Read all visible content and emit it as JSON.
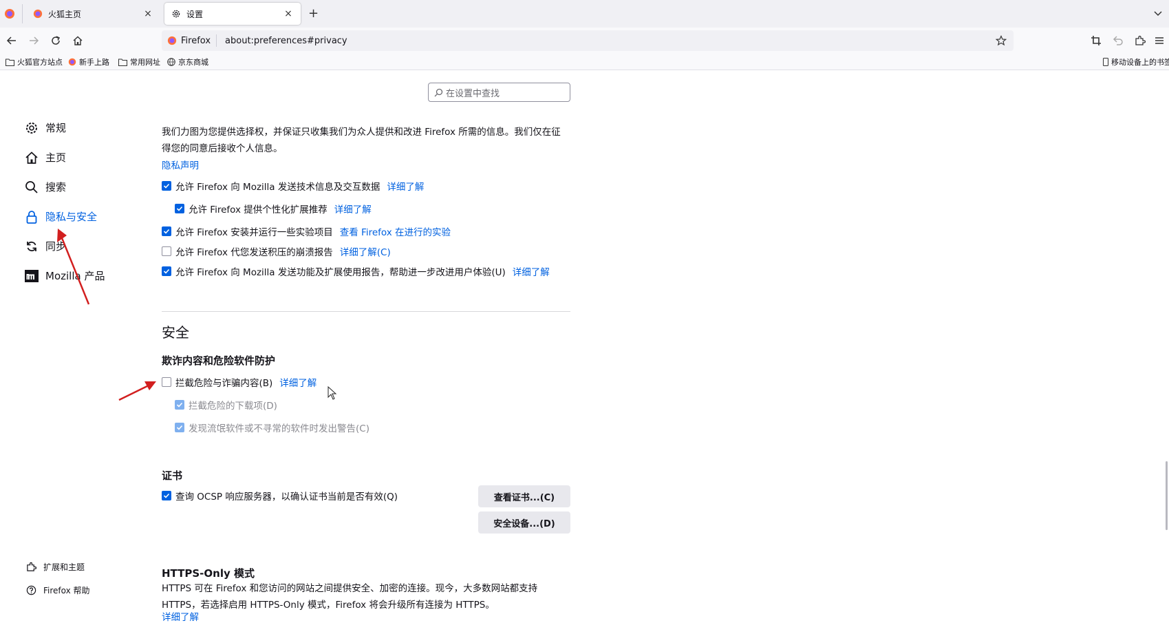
{
  "browser": {
    "tabs": [
      {
        "title": "火狐主页",
        "close": "×"
      },
      {
        "title": "设置",
        "close": "×"
      }
    ],
    "new_tab": "+",
    "url_identity": "Firefox",
    "url": "about:preferences#privacy",
    "bookmarks": [
      "火狐官方站点",
      "新手上路",
      "常用网址",
      "京东商城"
    ],
    "mobile_bookmarks": "移动设备上的书签"
  },
  "prefs": {
    "search_placeholder": "在设置中查找",
    "nav": [
      "常规",
      "主页",
      "搜索",
      "隐私与安全",
      "同步",
      "Mozilla 产品"
    ],
    "nav_footer": [
      "扩展和主题",
      "Firefox 帮助"
    ],
    "data_collection": {
      "intro_line1": "我们力图为您提供选择权，并保证只收集我们为众人提供和改进 Firefox 所需的信息。我们仅在征",
      "intro_line2": "得您的同意后接收个人信息。",
      "privacy_notice": "隐私声明",
      "items": [
        {
          "label": "允许 Firefox 向 Mozilla 发送技术信息及交互数据",
          "link": "详细了解",
          "checked": true
        },
        {
          "label": "允许 Firefox 提供个性化扩展推荐",
          "link": "详细了解",
          "checked": true
        },
        {
          "label": "允许 Firefox 安装并运行一些实验项目",
          "link": "查看 Firefox 在进行的实验",
          "checked": true
        },
        {
          "label": "允许 Firefox 代您发送积压的崩溃报告",
          "link": "详细了解(C)",
          "checked": false
        },
        {
          "label": "允许 Firefox 向 Mozilla 发送功能及扩展使用报告，帮助进一步改进用户体验(U)",
          "link": "详细了解",
          "checked": true
        }
      ]
    },
    "security": {
      "heading": "安全",
      "subheading": "欺诈内容和危险软件防护",
      "block_dangerous": {
        "label": "拦截危险与诈骗内容(B)",
        "link": "详细了解",
        "checked": false
      },
      "block_downloads": {
        "label": "拦截危险的下载项(D)",
        "checked": true
      },
      "warn_unwanted": {
        "label": "发现流氓软件或不寻常的软件时发出警告(C)",
        "checked": true
      }
    },
    "certificates": {
      "heading": "证书",
      "ocsp": {
        "label": "查询 OCSP 响应服务器，以确认证书当前是否有效(Q)",
        "checked": true
      },
      "view_button": "查看证书...(C)",
      "devices_button": "安全设备...(D)"
    },
    "https_only": {
      "heading": "HTTPS-Only 模式",
      "line1": "HTTPS 可在 Firefox 和您访问的网站之间提供安全、加密的连接。现今，大多数网站都支持",
      "line2": "HTTPS，若选择启用 HTTPS-Only 模式，Firefox 将会升级所有连接为 HTTPS。",
      "link": "详细了解"
    }
  },
  "colors": {
    "accent": "#0061e0",
    "annotation_arrow": "#d21f1f"
  }
}
